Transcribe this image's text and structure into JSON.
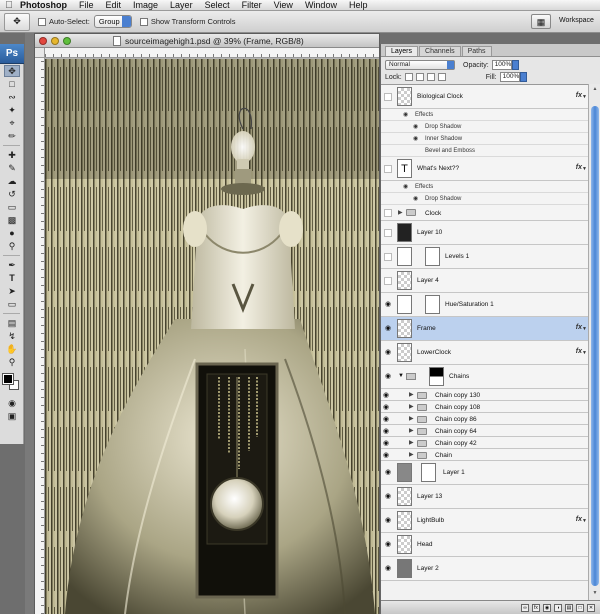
{
  "menubar": {
    "app": "Photoshop",
    "items": [
      "File",
      "Edit",
      "Image",
      "Layer",
      "Select",
      "Filter",
      "View",
      "Window",
      "Help"
    ]
  },
  "options": {
    "auto_select_label": "Auto-Select:",
    "auto_select_value": "Group",
    "show_transform_label": "Show Transform Controls",
    "workspace_label": "Workspace"
  },
  "document": {
    "title": "sourceimagehigh1.psd @ 39% (Frame, RGB/8)"
  },
  "panel": {
    "tabs": [
      "Layers",
      "Channels",
      "Paths"
    ],
    "blend_mode": "Normal",
    "opacity_label": "Opacity:",
    "opacity_value": "100%",
    "lock_label": "Lock:",
    "fill_label": "Fill:",
    "fill_value": "100%"
  },
  "layers": {
    "biological_clock": "Biological Clock",
    "effects": "Effects",
    "drop_shadow": "Drop Shadow",
    "inner_shadow": "Inner Shadow",
    "bevel_emboss": "Bevel and Emboss",
    "whats_next": "What's              Next??",
    "effects2": "Effects",
    "drop_shadow2": "Drop Shadow",
    "clock": "Clock",
    "layer10": "Layer 10",
    "levels1": "Levels 1",
    "layer4": "Layer 4",
    "huesat": "Hue/Saturation 1",
    "frame": "Frame",
    "lowerclock": "LowerClock",
    "chains": "Chains",
    "chain130": "Chain copy 130",
    "chain108": "Chain copy 108",
    "chain86": "Chain copy 86",
    "chain64": "Chain copy 64",
    "chain42": "Chain copy 42",
    "chain": "Chain",
    "layer1": "Layer 1",
    "layer13": "Layer 13",
    "lightbulb": "LightBulb",
    "head": "Head",
    "layer2": "Layer 2"
  },
  "icons": {
    "apple": "apple-icon",
    "eye": "eye-icon",
    "fx": "fx"
  }
}
